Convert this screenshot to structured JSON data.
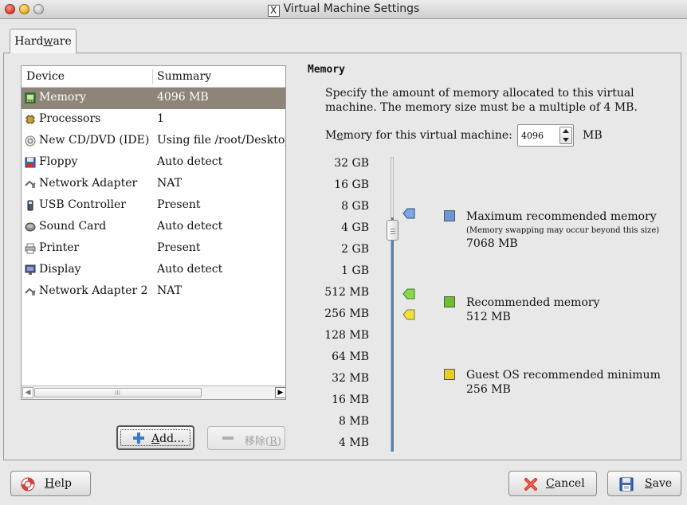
{
  "window": {
    "title": "Virtual Machine Settings",
    "x_icon_glyph": "X"
  },
  "tabs": [
    {
      "label_pre": "Hard",
      "label_u": "w",
      "label_post": "are"
    }
  ],
  "device_table": {
    "headers": [
      "Device",
      "Summary"
    ],
    "rows": [
      {
        "name": "Memory",
        "summary": "4096 MB",
        "icon": "memory-icon",
        "selected": true
      },
      {
        "name": "Processors",
        "summary": "1",
        "icon": "processor-icon"
      },
      {
        "name": "New CD/DVD (IDE)",
        "summary": "Using file /root/Desktop/!",
        "icon": "cd-icon"
      },
      {
        "name": "Floppy",
        "summary": "Auto detect",
        "icon": "floppy-icon"
      },
      {
        "name": "Network Adapter",
        "summary": "NAT",
        "icon": "network-icon"
      },
      {
        "name": "USB Controller",
        "summary": "Present",
        "icon": "usb-icon"
      },
      {
        "name": "Sound Card",
        "summary": "Auto detect",
        "icon": "sound-icon"
      },
      {
        "name": "Printer",
        "summary": "Present",
        "icon": "printer-icon"
      },
      {
        "name": "Display",
        "summary": "Auto detect",
        "icon": "display-icon"
      },
      {
        "name": "Network Adapter 2",
        "summary": "NAT",
        "icon": "network-icon"
      }
    ],
    "scroll_grip": "III"
  },
  "buttons": {
    "add": {
      "u": "A",
      "rest": "dd..."
    },
    "remove": {
      "label": "移除(",
      "u": "R",
      "post": ")"
    },
    "help": {
      "u": "H",
      "rest": "elp"
    },
    "cancel": {
      "u": "C",
      "rest": "ancel"
    },
    "save": {
      "u": "S",
      "rest": "ave"
    }
  },
  "memory": {
    "title": "Memory",
    "description": "Specify the amount of memory allocated to this virtual machine. The memory size must be a multiple of 4 MB.",
    "field_label_pre": "M",
    "field_label_u": "e",
    "field_label_post": "mory for this virtual machine:",
    "value": "4096",
    "unit": "MB",
    "scale_labels": [
      "32 GB",
      "16 GB",
      "8 GB",
      "4 GB",
      "2 GB",
      "1 GB",
      "512 MB",
      "256 MB",
      "128 MB",
      "64 MB",
      "32 MB",
      "16 MB",
      "8 MB",
      "4 MB"
    ],
    "legend": {
      "max": {
        "title": "Maximum recommended memory",
        "note": "(Memory swapping may occur beyond this size)",
        "value": "7068 MB",
        "color": "#5a86c8"
      },
      "recommended": {
        "title": "Recommended memory",
        "value": "512 MB",
        "color": "#6cc030"
      },
      "minimum": {
        "title": "Guest OS recommended minimum",
        "value": "256 MB",
        "color": "#e8d020"
      }
    }
  },
  "colors": {
    "selection": "#8d8578",
    "slider_fill": "#5a7fa8"
  }
}
